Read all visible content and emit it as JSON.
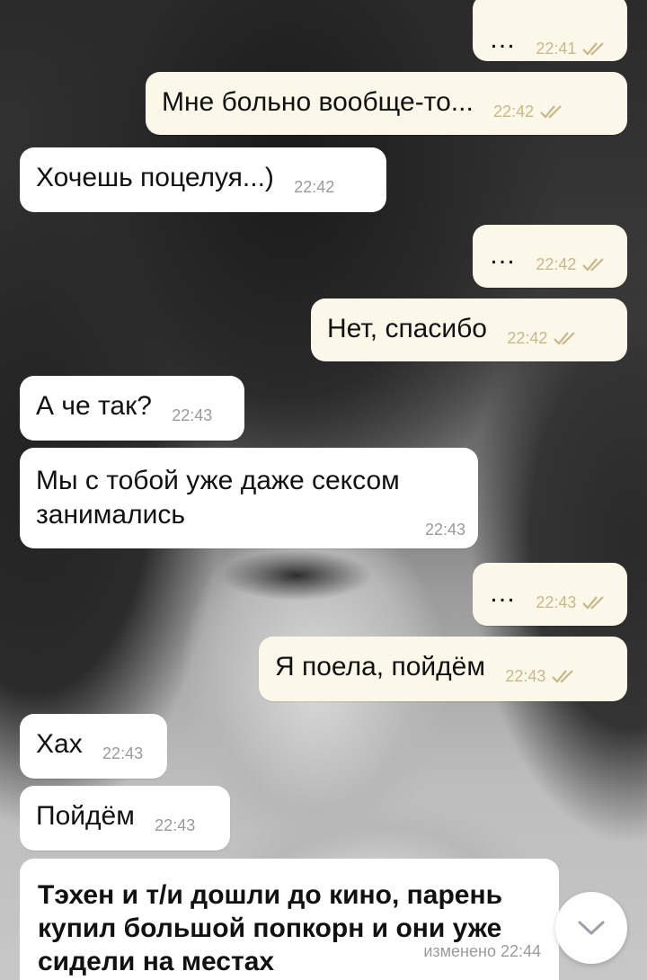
{
  "chat": {
    "messages": [
      {
        "dir": "out",
        "text": "…",
        "time": "22:41",
        "status": "read"
      },
      {
        "dir": "out",
        "text": "Мне больно вообще-то...",
        "time": "22:42",
        "status": "read"
      },
      {
        "dir": "in",
        "text": "Хочешь поцелуя...)",
        "time": "22:42"
      },
      {
        "dir": "out",
        "text": "…",
        "time": "22:42",
        "status": "read"
      },
      {
        "dir": "out",
        "text": "Нет, спасибо",
        "time": "22:42",
        "status": "read"
      },
      {
        "dir": "in",
        "text": "А че так?",
        "time": "22:43"
      },
      {
        "dir": "in",
        "text": "Мы с тобой уже даже сексом\nзанимались",
        "time": "22:43"
      },
      {
        "dir": "out",
        "text": "…",
        "time": "22:43",
        "status": "read"
      },
      {
        "dir": "out",
        "text": "Я поела, пойдём",
        "time": "22:43",
        "status": "read"
      },
      {
        "dir": "in",
        "text": "Хах",
        "time": "22:43"
      },
      {
        "dir": "in",
        "text": "Пойдём",
        "time": "22:43"
      }
    ],
    "story_message": {
      "text": "Тэхен и т/и дошли до кино, парень\nкупил большой попкорн и они уже\nсидели на местах",
      "meta": "изменено 22:44"
    }
  },
  "icons": {
    "read_ticks": "double-check-icon",
    "scroll_down": "chevron-down-icon"
  },
  "colors": {
    "incoming_bubble": "#ffffff",
    "outgoing_bubble": "#fbf8ea",
    "outgoing_time": "#c8b78a",
    "incoming_time": "#9a9a9a"
  }
}
